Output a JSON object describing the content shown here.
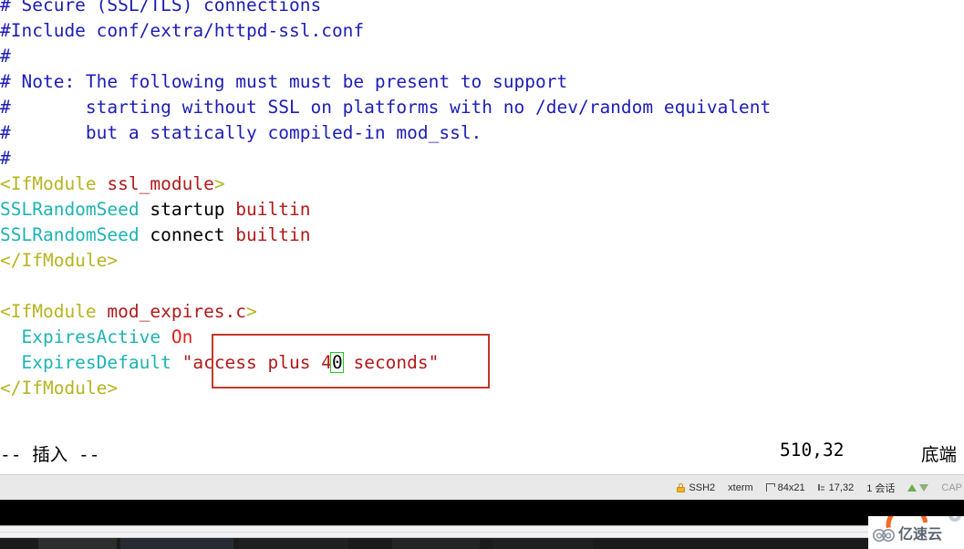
{
  "terminal": {
    "app": "vim",
    "colors": {
      "comment": "#1d1db4",
      "tag": "#b5b521",
      "arg": "#b01a1a",
      "directive": "#1fb3b3",
      "plain": "#000000",
      "on_keyword": "#e02020",
      "string": "#b01a1a",
      "cursor_border": "#22cc22",
      "annotation_box": "#c0392b",
      "background": "#ffffff"
    },
    "lines": [
      {
        "id": "l1",
        "segments": [
          {
            "text": "# Secure (SSL/TLS) connections",
            "cls": "c-comment"
          }
        ]
      },
      {
        "id": "l2",
        "segments": [
          {
            "text": "#Include conf/extra/httpd-ssl.conf",
            "cls": "c-comment"
          }
        ]
      },
      {
        "id": "l3",
        "segments": [
          {
            "text": "#",
            "cls": "c-comment"
          }
        ]
      },
      {
        "id": "l4",
        "segments": [
          {
            "text": "# Note: The following must must be present to support",
            "cls": "c-comment"
          }
        ]
      },
      {
        "id": "l5",
        "segments": [
          {
            "text": "#       starting without SSL on platforms with no /dev/random equivalent",
            "cls": "c-comment"
          }
        ]
      },
      {
        "id": "l6",
        "segments": [
          {
            "text": "#       but a statically compiled-in mod_ssl.",
            "cls": "c-comment"
          }
        ]
      },
      {
        "id": "l7",
        "segments": [
          {
            "text": "#",
            "cls": "c-comment"
          }
        ]
      },
      {
        "id": "l8",
        "segments": [
          {
            "text": "<IfModule ",
            "cls": "c-tag"
          },
          {
            "text": "ssl_module",
            "cls": "c-arg"
          },
          {
            "text": ">",
            "cls": "c-tag"
          }
        ]
      },
      {
        "id": "l9",
        "segments": [
          {
            "text": "SSLRandomSeed",
            "cls": "c-dir"
          },
          {
            "text": " startup ",
            "cls": "c-plain"
          },
          {
            "text": "builtin",
            "cls": "c-arg"
          }
        ]
      },
      {
        "id": "l10",
        "segments": [
          {
            "text": "SSLRandomSeed",
            "cls": "c-dir"
          },
          {
            "text": " connect ",
            "cls": "c-plain"
          },
          {
            "text": "builtin",
            "cls": "c-arg"
          }
        ]
      },
      {
        "id": "l11",
        "segments": [
          {
            "text": "</IfModule>",
            "cls": "c-tag"
          }
        ]
      },
      {
        "id": "l12",
        "segments": [
          {
            "text": "",
            "cls": "c-plain"
          }
        ]
      },
      {
        "id": "l13",
        "segments": [
          {
            "text": "<IfModule ",
            "cls": "c-tag"
          },
          {
            "text": "mod_expires.c",
            "cls": "c-arg"
          },
          {
            "text": ">",
            "cls": "c-tag"
          }
        ]
      },
      {
        "id": "l14",
        "segments": [
          {
            "text": "  ExpiresActive",
            "cls": "c-dir"
          },
          {
            "text": " ",
            "cls": "c-plain"
          },
          {
            "text": "On",
            "cls": "c-on"
          }
        ]
      },
      {
        "id": "l15",
        "segments": [
          {
            "text": "  ExpiresDefault",
            "cls": "c-dir"
          },
          {
            "text": " ",
            "cls": "c-plain"
          },
          {
            "text": "\"access plus 4",
            "cls": "c-str"
          },
          {
            "text": "0",
            "cls": "cursor",
            "cursor": true
          },
          {
            "text": " seconds\"",
            "cls": "c-str"
          }
        ]
      },
      {
        "id": "l16",
        "segments": [
          {
            "text": "</IfModule>",
            "cls": "c-tag"
          }
        ]
      }
    ],
    "annotation": {
      "label": "red-highlight-rectangle",
      "color": "#c0392b"
    },
    "cursor": {
      "character": "0",
      "style": "block",
      "color": "#22cc22"
    }
  },
  "vim_status": {
    "mode": "-- 插入 --",
    "position": "510,32",
    "location": "底端"
  },
  "statusbar": {
    "protocol": "SSH2",
    "terminal_type": "xterm",
    "dimensions": "84x21",
    "cursor_position": "17,32",
    "sessions": "1 会话",
    "cap": "CAP",
    "icons": {
      "lock": "lock-icon",
      "size": "terminal-size-icon",
      "position": "cursor-position-icon",
      "arrow_up": "arrow-up-icon",
      "arrow_down": "arrow-down-icon"
    }
  },
  "watermark": {
    "text": "亿速云",
    "icon": "cloud-logo-icon"
  }
}
